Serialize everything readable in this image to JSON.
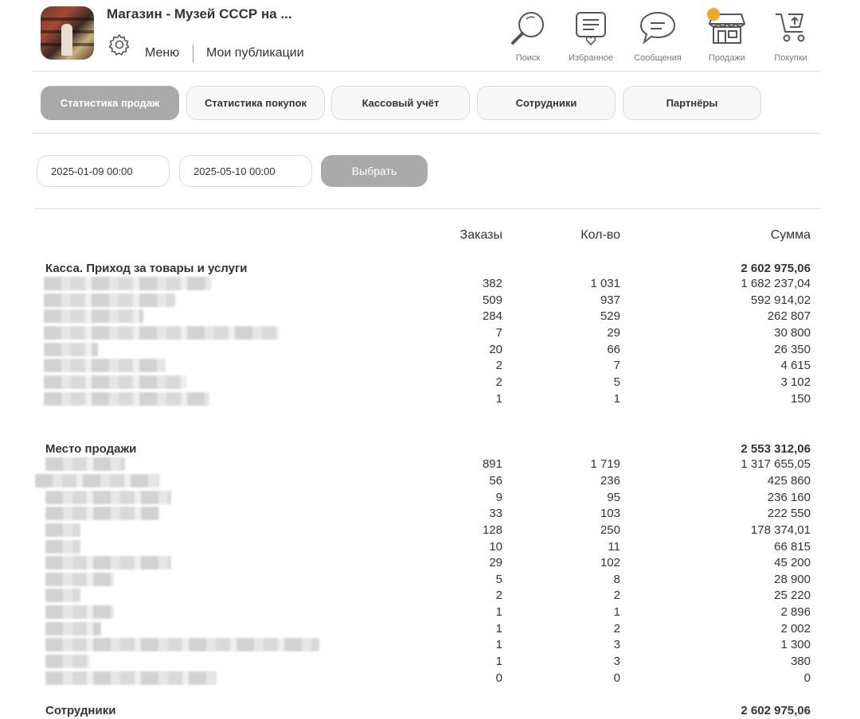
{
  "header": {
    "shop_title": "Магазин - Музей СССР на ...",
    "menu_label": "Меню",
    "publications_label": "Мои публикации",
    "nav": [
      {
        "label": "Поиск",
        "icon": "search-icon"
      },
      {
        "label": "Избранное",
        "icon": "favorites-icon"
      },
      {
        "label": "Сообщения",
        "icon": "messages-icon"
      },
      {
        "label": "Продажи",
        "icon": "store-icon",
        "has_notification": true
      },
      {
        "label": "Покупки",
        "icon": "cart-icon"
      }
    ],
    "notification_color": "#f5a623"
  },
  "tabs": [
    {
      "label": "Статистика продаж",
      "active": true
    },
    {
      "label": "Статистика покупок",
      "active": false
    },
    {
      "label": "Кассовый учёт",
      "active": false
    },
    {
      "label": "Сотрудники",
      "active": false
    },
    {
      "label": "Партнёры",
      "active": false
    }
  ],
  "filters": {
    "date_from": "2025-01-09 00:00",
    "date_to": "2025-05-10 00:00",
    "select_label": "Выбрать"
  },
  "columns": {
    "orders": "Заказы",
    "qty": "Кол-во",
    "sum": "Сумма"
  },
  "sections": [
    {
      "title": "Касса. Приход за товары и услуги",
      "total": "2 602 975,06",
      "rows": [
        {
          "orders": "382",
          "qty": "1 031",
          "sum": "1 682 237,04"
        },
        {
          "orders": "509",
          "qty": "937",
          "sum": "592 914,02"
        },
        {
          "orders": "284",
          "qty": "529",
          "sum": "262 807"
        },
        {
          "orders": "7",
          "qty": "29",
          "sum": "30 800"
        },
        {
          "orders": "20",
          "qty": "66",
          "sum": "26 350"
        },
        {
          "orders": "2",
          "qty": "7",
          "sum": "4 615"
        },
        {
          "orders": "2",
          "qty": "5",
          "sum": "3 102"
        },
        {
          "orders": "1",
          "qty": "1",
          "sum": "150"
        }
      ]
    },
    {
      "title": "Место продажи",
      "total": "2 553 312,06",
      "rows": [
        {
          "orders": "891",
          "qty": "1 719",
          "sum": "1 317 655,05"
        },
        {
          "orders": "56",
          "qty": "236",
          "sum": "425 860"
        },
        {
          "orders": "9",
          "qty": "95",
          "sum": "236 160"
        },
        {
          "orders": "33",
          "qty": "103",
          "sum": "222 550"
        },
        {
          "orders": "128",
          "qty": "250",
          "sum": "178 374,01"
        },
        {
          "orders": "10",
          "qty": "11",
          "sum": "66 815"
        },
        {
          "orders": "29",
          "qty": "102",
          "sum": "45 200"
        },
        {
          "orders": "5",
          "qty": "8",
          "sum": "28 900"
        },
        {
          "orders": "2",
          "qty": "2",
          "sum": "25 220"
        },
        {
          "orders": "1",
          "qty": "1",
          "sum": "2 896"
        },
        {
          "orders": "1",
          "qty": "2",
          "sum": "2 002"
        },
        {
          "orders": "1",
          "qty": "3",
          "sum": "1 300"
        },
        {
          "orders": "1",
          "qty": "3",
          "sum": "380"
        },
        {
          "orders": "0",
          "qty": "0",
          "sum": "0"
        }
      ]
    },
    {
      "title": "Сотрудники",
      "total": "2 602 975,06",
      "rows": []
    }
  ]
}
